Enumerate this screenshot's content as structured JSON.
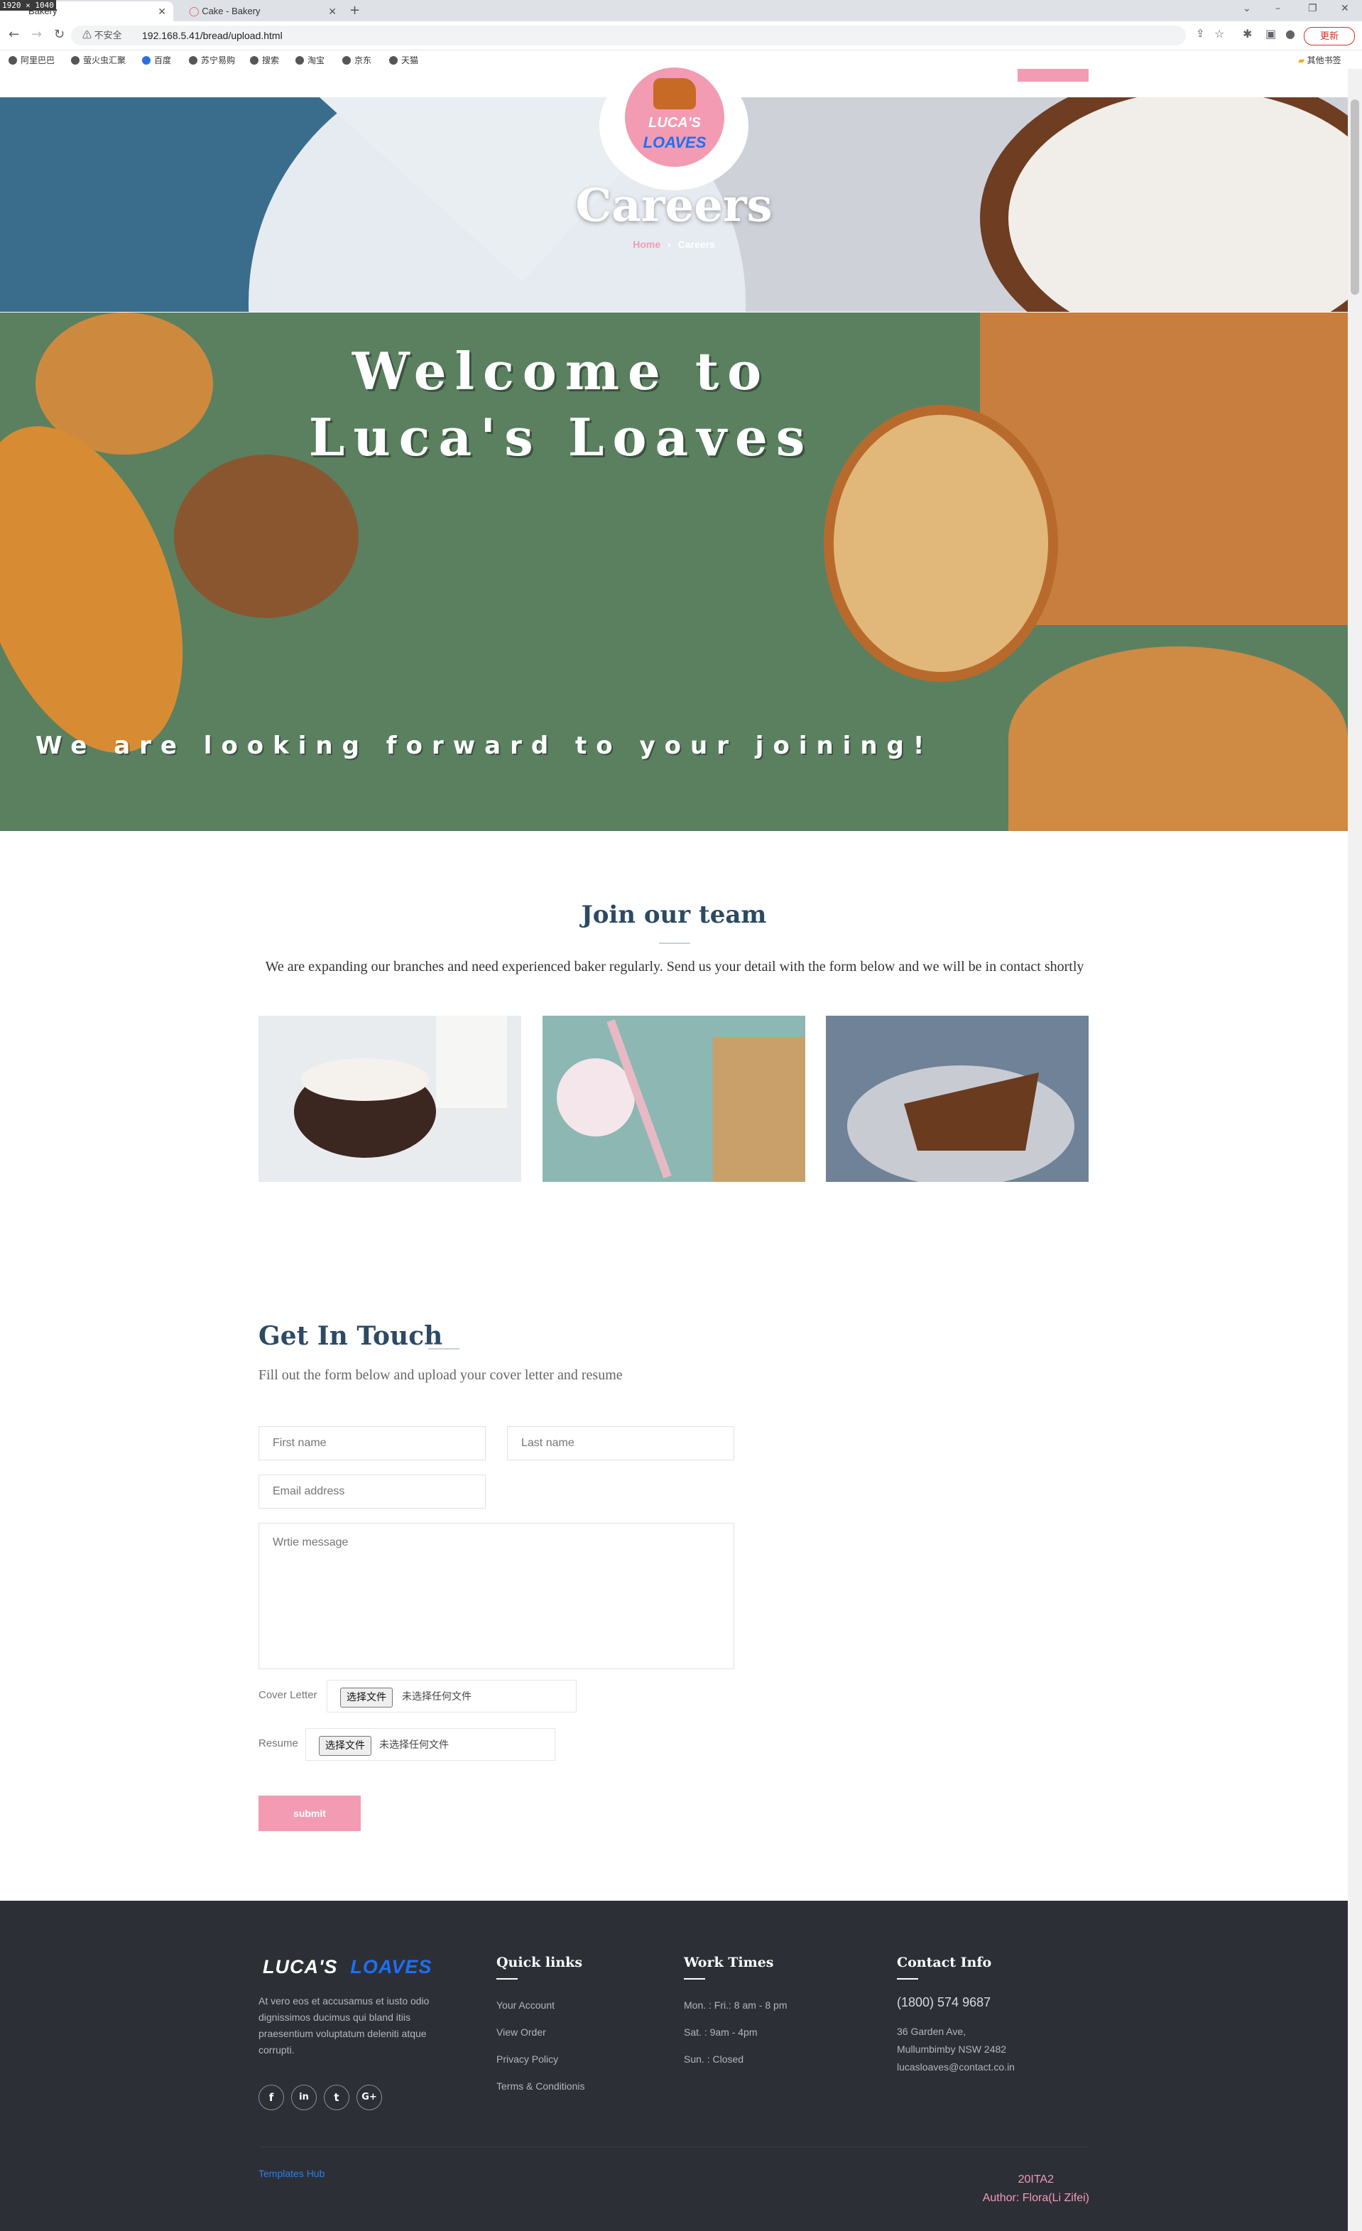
{
  "browser": {
    "dimension_badge": "1920 × 1040",
    "tabs": [
      {
        "label": "Bakery",
        "active": true
      },
      {
        "label": "Cake - Bakery",
        "active": false
      }
    ],
    "url_warning": "不安全",
    "url": "192.168.5.41/bread/upload.html",
    "update_label": "更新",
    "bookmarks": [
      "阿里巴巴",
      "萤火虫汇聚",
      "百度",
      "苏宁易购",
      "搜索",
      "淘宝",
      "京东",
      "天猫"
    ],
    "other_bookmarks": "其他书签"
  },
  "hero": {
    "logo_line1": "LUCA'S",
    "logo_line2": "LOAVES",
    "title": "Careers",
    "breadcrumb_home": "Home",
    "breadcrumb_sep": "›",
    "breadcrumb_current": "Careers"
  },
  "banner": {
    "line1": "Welcome to",
    "line2": "Luca's Loaves",
    "sub": "We are looking forward to your joining!"
  },
  "join": {
    "title": "Join our team",
    "text": "We are expanding our branches and need experienced baker regularly. Send us your detail with the form below and we will be in contact shortly"
  },
  "touch": {
    "title": "Get In Touch",
    "subtitle": "Fill out the form below and upload your cover letter and resume",
    "first_name_placeholder": "First name",
    "last_name_placeholder": "Last name",
    "email_placeholder": "Email address",
    "message_placeholder": "Wrtie message",
    "cover_letter_label": "Cover Letter",
    "resume_label": "Resume",
    "file_button": "选择文件",
    "file_none": "未选择任何文件",
    "submit": "submit"
  },
  "footer": {
    "logo1": "LUCA'S",
    "logo2": "LOAVES",
    "about": "At vero eos et accusamus et iusto odio dignissimos ducimus qui bland itiis praesentium voluptatum deleniti atque corrupti.",
    "social": [
      "f",
      "in",
      "t",
      "G+"
    ],
    "quick_links_title": "Quick links",
    "quick_links": [
      "Your Account",
      "View Order",
      "Privacy Policy",
      "Terms & Conditionis"
    ],
    "work_times_title": "Work Times",
    "work_times": [
      "Mon. : Fri.: 8 am - 8 pm",
      "Sat. : 9am - 4pm",
      "Sun. : Closed"
    ],
    "contact_title": "Contact Info",
    "phone": "(1800) 574 9687",
    "address": [
      "36 Garden Ave,",
      "Mullumbimby NSW 2482",
      "lucasloaves@contact.co.in"
    ],
    "templates_hub": "Templates Hub",
    "credit1": "20ITA2",
    "credit2": "Author: Flora(Li Zifei)"
  },
  "colors": {
    "accent_pink": "#f29bb3",
    "heading_navy": "#2c4a63",
    "banner_green": "#5a8060",
    "footer_bg": "#2d2f37",
    "logo_blue": "#1e6ff5"
  }
}
